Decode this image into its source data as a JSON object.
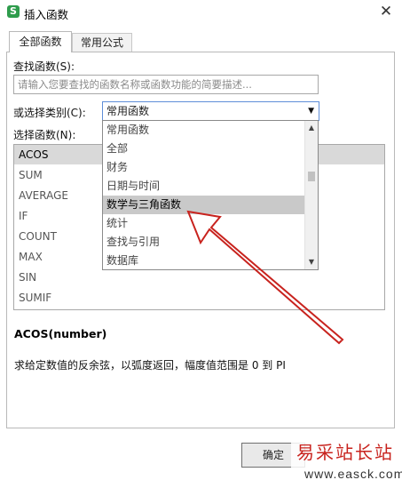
{
  "window": {
    "title": "插入函数",
    "app_icon_letter": "S"
  },
  "tabs": [
    {
      "label": "全部函数"
    },
    {
      "label": "常用公式"
    }
  ],
  "search": {
    "label": "查找函数(S):",
    "placeholder": "请输入您要查找的函数名称或函数功能的简要描述..."
  },
  "category": {
    "label": "或选择类别(C):",
    "selected": "常用函数",
    "options": [
      "常用函数",
      "全部",
      "财务",
      "日期与时间",
      "数学与三角函数",
      "统计",
      "查找与引用",
      "数据库"
    ],
    "hovered_index": 4
  },
  "function_list": {
    "label": "选择函数(N):",
    "items": [
      "ACOS",
      "SUM",
      "AVERAGE",
      "IF",
      "COUNT",
      "MAX",
      "SIN",
      "SUMIF"
    ],
    "selected_index": 0
  },
  "syntax": "ACOS(number)",
  "description": "求给定数值的反余弦，以弧度返回，幅度值范围是 0 到 PI",
  "buttons": {
    "ok_label": "确定"
  },
  "watermark": {
    "title": "易采站长站",
    "url": "www.easck.com"
  },
  "colors": {
    "annotation_arrow": "#c8231e",
    "app_icon": "#2e9c4c",
    "select_border": "#5f8ed8"
  }
}
